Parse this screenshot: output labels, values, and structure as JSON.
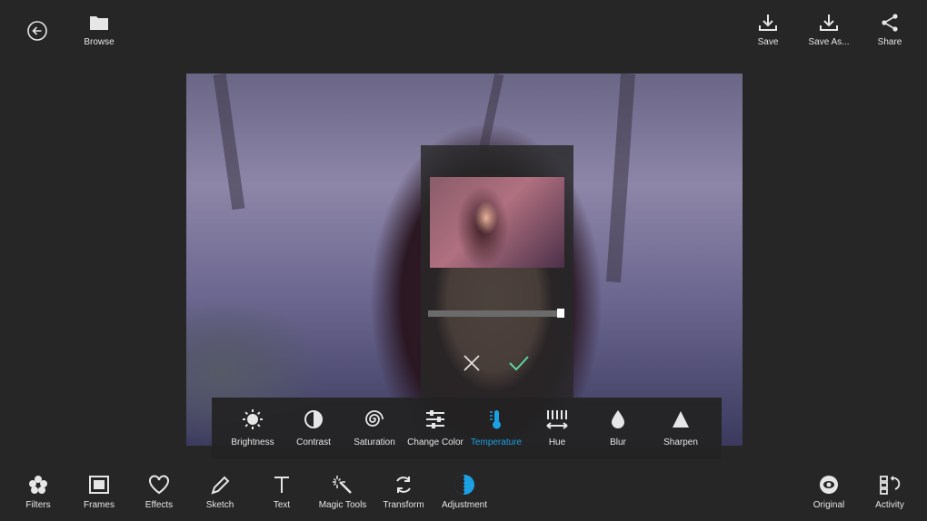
{
  "topbar": {
    "back_icon": "back-arrow-icon",
    "browse_label": "Browse",
    "save_label": "Save",
    "save_as_label": "Save As...",
    "share_label": "Share"
  },
  "adjustment_tools": [
    {
      "label": "Brightness",
      "icon": "sun-icon"
    },
    {
      "label": "Contrast",
      "icon": "contrast-icon"
    },
    {
      "label": "Saturation",
      "icon": "saturation-spiral-icon"
    },
    {
      "label": "Change Color",
      "icon": "sliders-icon"
    },
    {
      "label": "Temperature",
      "icon": "thermometer-icon",
      "active": true
    },
    {
      "label": "Hue",
      "icon": "hue-icon"
    },
    {
      "label": "Blur",
      "icon": "drop-icon"
    },
    {
      "label": "Sharpen",
      "icon": "triangle-icon"
    }
  ],
  "temperature_slider": {
    "value": 1.0
  },
  "bottombar": {
    "items": [
      {
        "label": "Filters",
        "icon": "flower-icon"
      },
      {
        "label": "Frames",
        "icon": "frame-icon"
      },
      {
        "label": "Effects",
        "icon": "heart-icon"
      },
      {
        "label": "Sketch",
        "icon": "pencil-icon"
      },
      {
        "label": "Text",
        "icon": "text-icon"
      },
      {
        "label": "Magic Tools",
        "icon": "magic-wand-icon"
      },
      {
        "label": "Transform",
        "icon": "transform-icon"
      },
      {
        "label": "Adjustment",
        "icon": "adjustment-icon",
        "active": true
      }
    ],
    "right_items": [
      {
        "label": "Original",
        "icon": "eye-icon"
      },
      {
        "label": "Activity",
        "icon": "activity-icon"
      }
    ]
  },
  "colors": {
    "accent": "#1ba1e2",
    "confirm": "#5fd4a0",
    "background": "#262626"
  }
}
